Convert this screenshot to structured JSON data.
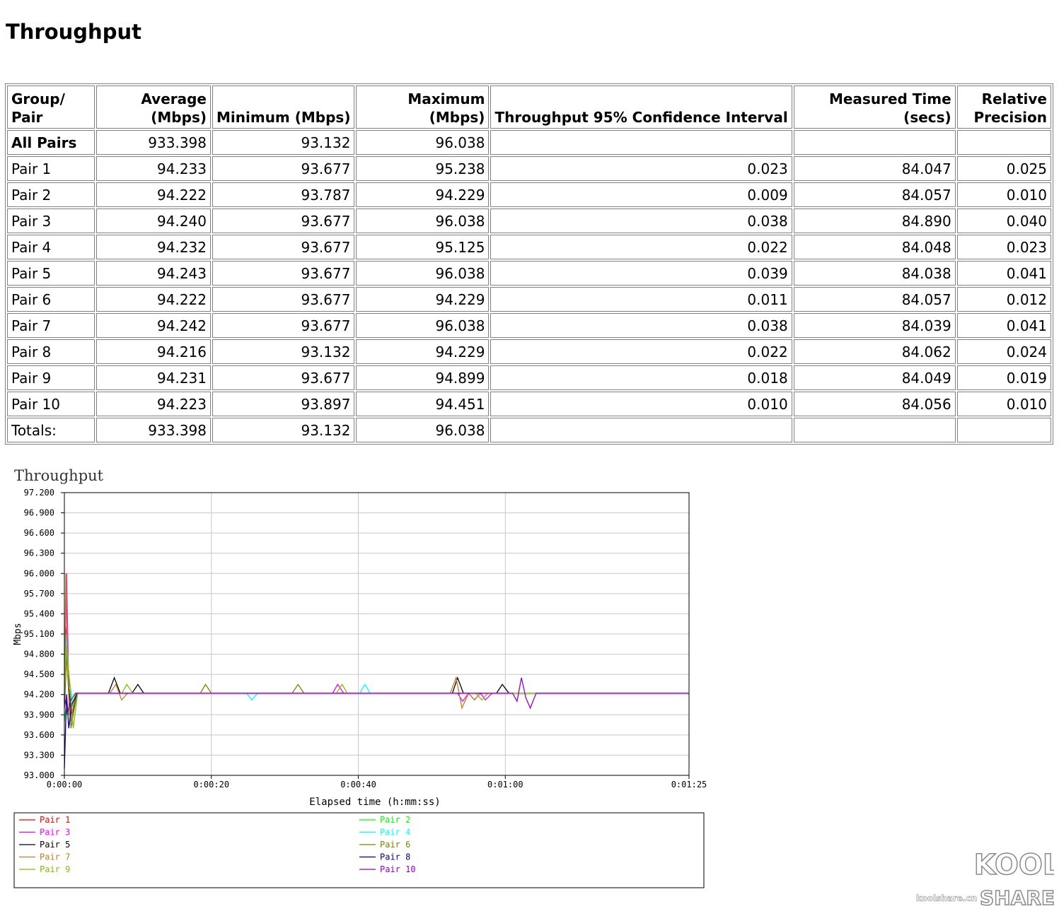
{
  "page": {
    "title": "Throughput"
  },
  "table": {
    "headers": [
      "Group/ Pair",
      "Average (Mbps)",
      "Minimum (Mbps)",
      "Maximum (Mbps)",
      "Throughput 95% Confidence Interval",
      "Measured Time (secs)",
      "Relative Precision"
    ],
    "rows": [
      [
        "All Pairs",
        "933.398",
        "93.132",
        "96.038",
        "",
        "",
        ""
      ],
      [
        "Pair 1",
        "94.233",
        "93.677",
        "95.238",
        "0.023",
        "84.047",
        "0.025"
      ],
      [
        "Pair 2",
        "94.222",
        "93.787",
        "94.229",
        "0.009",
        "84.057",
        "0.010"
      ],
      [
        "Pair 3",
        "94.240",
        "93.677",
        "96.038",
        "0.038",
        "84.890",
        "0.040"
      ],
      [
        "Pair 4",
        "94.232",
        "93.677",
        "95.125",
        "0.022",
        "84.048",
        "0.023"
      ],
      [
        "Pair 5",
        "94.243",
        "93.677",
        "96.038",
        "0.039",
        "84.038",
        "0.041"
      ],
      [
        "Pair 6",
        "94.222",
        "93.677",
        "94.229",
        "0.011",
        "84.057",
        "0.012"
      ],
      [
        "Pair 7",
        "94.242",
        "93.677",
        "96.038",
        "0.038",
        "84.039",
        "0.041"
      ],
      [
        "Pair 8",
        "94.216",
        "93.132",
        "94.229",
        "0.022",
        "84.062",
        "0.024"
      ],
      [
        "Pair 9",
        "94.231",
        "93.677",
        "94.899",
        "0.018",
        "84.049",
        "0.019"
      ],
      [
        "Pair 10",
        "94.223",
        "93.897",
        "94.451",
        "0.010",
        "84.056",
        "0.010"
      ],
      [
        "Totals:",
        "933.398",
        "93.132",
        "96.038",
        "",
        "",
        ""
      ]
    ]
  },
  "chart_data": {
    "type": "line",
    "title": "Throughput",
    "xlabel": "Elapsed time (h:mm:ss)",
    "ylabel": "Mbps",
    "xlim": [
      0,
      85
    ],
    "ylim": [
      93.0,
      97.2
    ],
    "x_ticks": [
      {
        "value": 0,
        "label": "0:00:00"
      },
      {
        "value": 20,
        "label": "0:00:20"
      },
      {
        "value": 40,
        "label": "0:00:40"
      },
      {
        "value": 60,
        "label": "0:01:00"
      },
      {
        "value": 85,
        "label": "0:01:25"
      }
    ],
    "y_ticks": [
      "93.000",
      "93.300",
      "93.600",
      "93.900",
      "94.200",
      "94.500",
      "94.800",
      "95.100",
      "95.400",
      "95.700",
      "96.000",
      "96.300",
      "96.600",
      "96.900",
      "97.200"
    ],
    "grid": true,
    "legend_position": "bottom",
    "series": [
      {
        "name": "Pair 1",
        "color": "#ff0000",
        "x": [
          0,
          0.2,
          0.4,
          0.7,
          1.2,
          1.8,
          85
        ],
        "y": [
          94.1,
          95.2,
          94.7,
          93.9,
          94.1,
          94.22,
          94.22
        ]
      },
      {
        "name": "Pair 2",
        "color": "#00ff00",
        "x": [
          0,
          0.3,
          0.6,
          1.0,
          1.6,
          85
        ],
        "y": [
          93.8,
          94.1,
          93.9,
          94.05,
          94.22,
          94.22
        ]
      },
      {
        "name": "Pair 3",
        "color": "#ff00ff",
        "x": [
          0,
          0.3,
          0.6,
          0.9,
          1.8,
          36.5,
          37.2,
          38.0,
          53.5,
          54.2,
          55.0,
          55.8,
          56.6,
          57.3,
          58.2,
          85
        ],
        "y": [
          94.2,
          96.0,
          94.3,
          93.8,
          94.22,
          94.22,
          94.35,
          94.22,
          94.22,
          94.1,
          94.22,
          94.12,
          94.22,
          94.12,
          94.22,
          94.22
        ]
      },
      {
        "name": "Pair 4",
        "color": "#00ffff",
        "x": [
          0,
          0.3,
          0.6,
          1.2,
          1.8,
          24.8,
          25.5,
          26.3,
          40.2,
          40.9,
          41.6,
          85
        ],
        "y": [
          94.1,
          95.1,
          94.5,
          94.0,
          94.22,
          94.22,
          94.12,
          94.22,
          94.22,
          94.35,
          94.22,
          94.22
        ]
      },
      {
        "name": "Pair 5",
        "color": "#000000",
        "x": [
          0,
          0.3,
          0.6,
          1.0,
          1.7,
          6.0,
          6.8,
          7.6,
          9.2,
          10.0,
          10.8,
          52.8,
          53.5,
          54.3,
          58.8,
          59.6,
          60.5,
          85
        ],
        "y": [
          94.0,
          94.8,
          94.3,
          93.9,
          94.22,
          94.22,
          94.45,
          94.22,
          94.22,
          94.35,
          94.22,
          94.22,
          94.45,
          94.22,
          94.22,
          94.35,
          94.22,
          94.22
        ]
      },
      {
        "name": "Pair 6",
        "color": "#808000",
        "x": [
          0,
          0.3,
          0.6,
          0.9,
          1.7,
          18.5,
          19.2,
          20.0,
          31.0,
          31.8,
          32.6,
          85
        ],
        "y": [
          94.2,
          94.8,
          94.2,
          93.7,
          94.22,
          94.22,
          94.35,
          94.22,
          94.22,
          94.35,
          94.22,
          94.22
        ]
      },
      {
        "name": "Pair 7",
        "color": "#c08020",
        "x": [
          0,
          0.2,
          0.5,
          0.8,
          1.6,
          6.2,
          7.0,
          7.8,
          8.6,
          52.5,
          53.3,
          54.1,
          55.0,
          55.8,
          56.6,
          85
        ],
        "y": [
          94.1,
          96.0,
          94.4,
          93.8,
          94.22,
          94.22,
          94.35,
          94.12,
          94.22,
          94.22,
          94.45,
          94.0,
          94.22,
          94.12,
          94.22,
          94.22
        ]
      },
      {
        "name": "Pair 8",
        "color": "#00008b",
        "x": [
          0,
          0.3,
          0.6,
          1.0,
          1.8,
          85
        ],
        "y": [
          93.1,
          94.2,
          93.7,
          94.05,
          94.22,
          94.22
        ]
      },
      {
        "name": "Pair 9",
        "color": "#80c000",
        "x": [
          0,
          0.3,
          0.7,
          1.2,
          1.8,
          7.8,
          8.5,
          9.3,
          37.0,
          37.8,
          38.5,
          56.0,
          56.8,
          57.6,
          85
        ],
        "y": [
          94.1,
          94.9,
          94.4,
          93.7,
          94.22,
          94.22,
          94.35,
          94.22,
          94.22,
          94.35,
          94.22,
          94.22,
          94.12,
          94.22,
          94.22
        ]
      },
      {
        "name": "Pair 10",
        "color": "#9400d3",
        "x": [
          0,
          0.4,
          0.8,
          1.5,
          61.0,
          61.6,
          62.2,
          62.8,
          63.4,
          64.2,
          85
        ],
        "y": [
          94.2,
          93.9,
          94.1,
          94.22,
          94.22,
          94.1,
          94.45,
          94.15,
          94.0,
          94.22,
          94.22
        ]
      }
    ]
  },
  "watermark": {
    "brand_top": "KOOL",
    "brand_bottom": "SHARE",
    "site": "koolshare.cn"
  }
}
